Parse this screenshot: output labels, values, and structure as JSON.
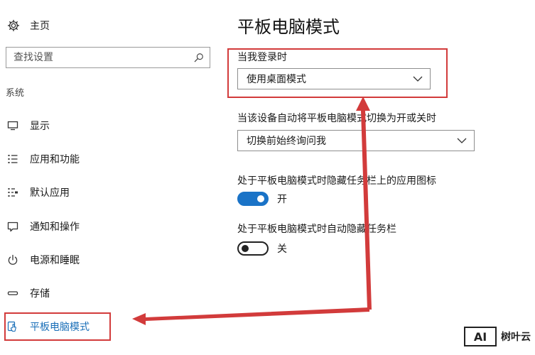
{
  "sidebar": {
    "home_label": "主页",
    "search_placeholder": "查找设置",
    "section_label": "系统",
    "items": [
      {
        "label": "显示",
        "icon": "monitor-icon"
      },
      {
        "label": "应用和功能",
        "icon": "list-icon"
      },
      {
        "label": "默认应用",
        "icon": "default-apps-icon"
      },
      {
        "label": "通知和操作",
        "icon": "message-icon"
      },
      {
        "label": "电源和睡眠",
        "icon": "power-icon"
      },
      {
        "label": "存储",
        "icon": "storage-icon"
      },
      {
        "label": "平板电脑模式",
        "icon": "tablet-mode-icon",
        "active": true
      }
    ]
  },
  "content": {
    "title": "平板电脑模式",
    "signin": {
      "label": "当我登录时",
      "value": "使用桌面模式"
    },
    "switch_prompt": {
      "label": "当该设备自动将平板电脑模式切换为开或关时",
      "value": "切换前始终询问我"
    },
    "hide_icons": {
      "label": "处于平板电脑模式时隐藏任务栏上的应用图标",
      "state": "开",
      "on": true
    },
    "auto_hide": {
      "label": "处于平板电脑模式时自动隐藏任务栏",
      "state": "关",
      "on": false
    }
  },
  "watermark": {
    "logo_text": "AI",
    "text": "树叶云"
  },
  "colors": {
    "accent": "#1a73c7",
    "active_text": "#1a6fb8",
    "annotation": "#d23b3b"
  }
}
